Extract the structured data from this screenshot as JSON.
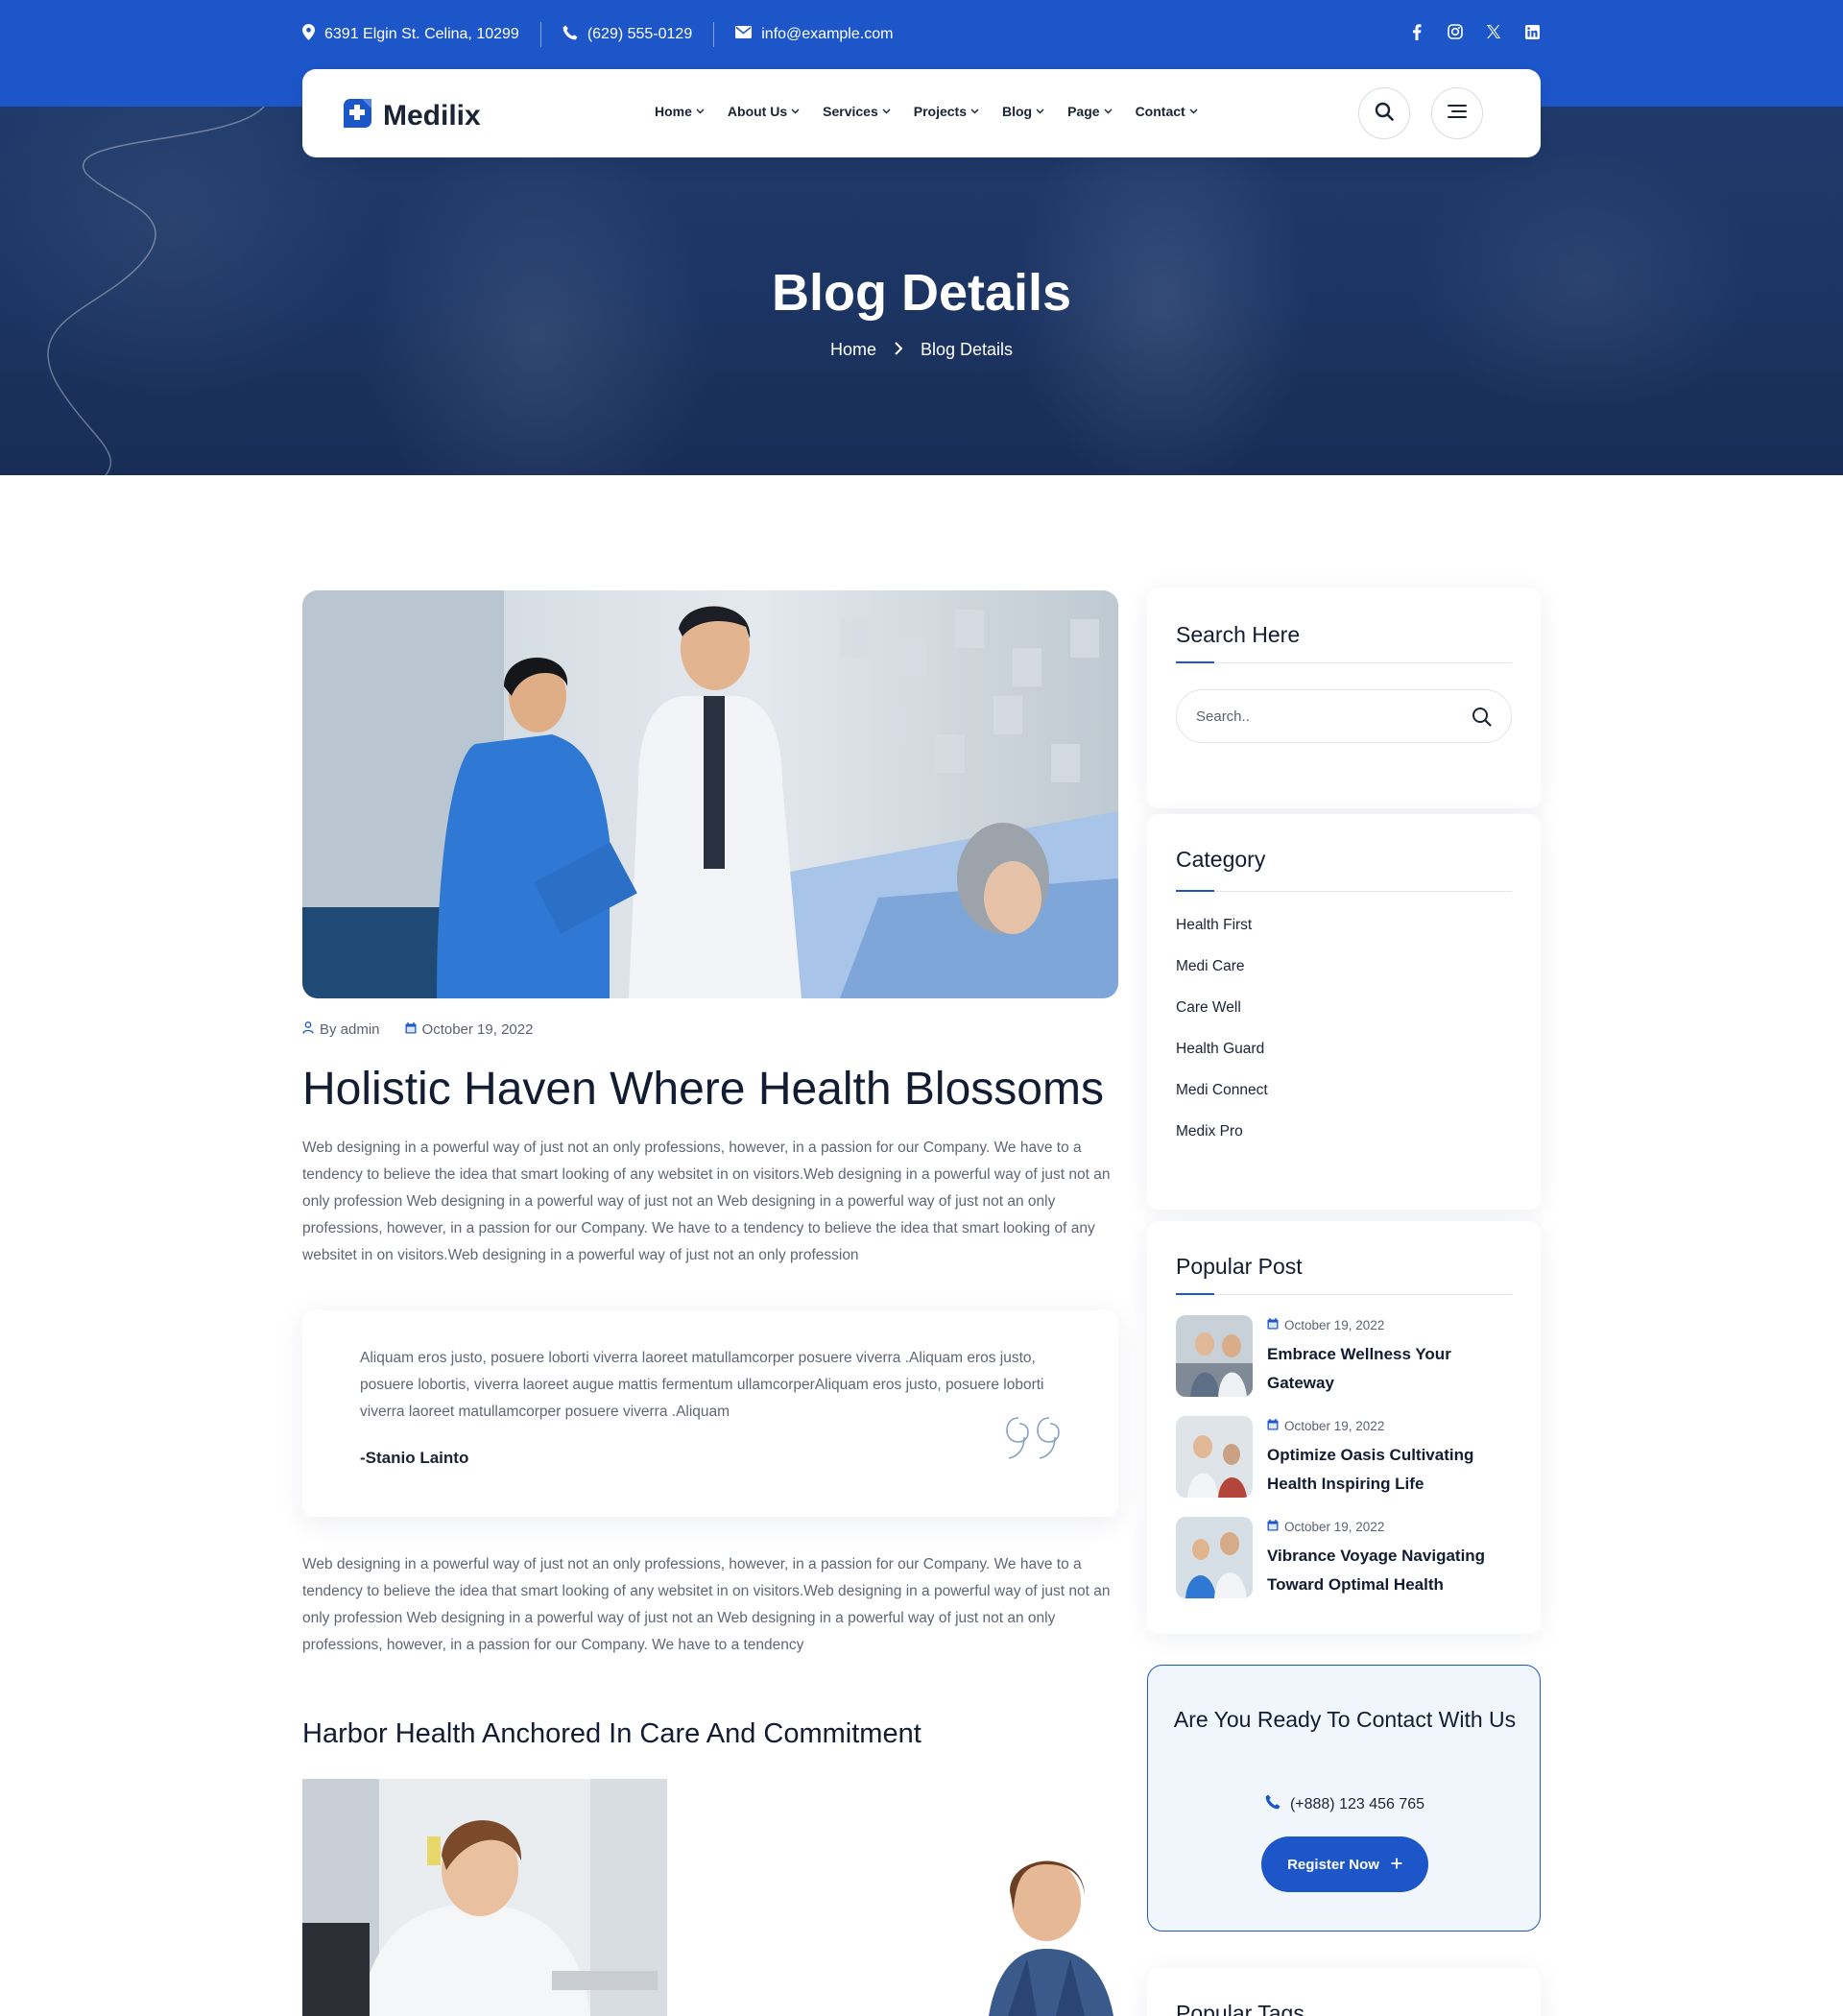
{
  "topbar": {
    "address": "6391 Elgin St. Celina, 10299",
    "phone": "(629) 555-0129",
    "email": "info@example.com",
    "social": [
      "facebook-icon",
      "instagram-icon",
      "x-icon",
      "linkedin-icon"
    ]
  },
  "brand": {
    "name": "Medilix",
    "accent": "#1d56c9",
    "dark": "#1b2435"
  },
  "nav": {
    "items": [
      "Home",
      "About Us",
      "Services",
      "Projects",
      "Blog",
      "Page",
      "Contact"
    ]
  },
  "hero": {
    "title": "Blog Details",
    "breadcrumb_home": "Home",
    "breadcrumb_current": "Blog Details"
  },
  "post": {
    "author": "By admin",
    "date": "October 19, 2022",
    "title": "Holistic Haven Where Health Blossoms",
    "para1": "Web designing in a powerful way of just not an only professions, however, in a passion for our Company. We have to a tendency to believe the idea that smart looking of any websitet in on visitors.Web designing in a powerful way of just not an only profession Web designing in a powerful way of just not an Web designing in a powerful way of just not an only professions, however, in a passion for our Company. We have to a tendency to believe the idea that smart looking of any websitet in on visitors.Web designing in a powerful way of just not an only profession",
    "quote": "Aliquam eros justo, posuere loborti viverra laoreet matullamcorper posuere viverra .Aliquam eros justo, posuere lobortis, viverra laoreet augue mattis fermentum ullamcorperAliquam eros justo, posuere loborti viverra laoreet matullamcorper posuere viverra .Aliquam",
    "quote_author": "-Stanio Lainto",
    "para2": "Web designing in a powerful way of just not an only professions, however, in a passion for our Company. We have to a tendency to believe the idea that smart looking of any websitet in on visitors.Web designing in a powerful way of just not an only profession Web designing in a powerful way of just not an Web designing in a powerful way of just not an only professions, however, in a passion for our Company. We have to a tendency",
    "subheading": "Harbor Health Anchored In Care And Commitment"
  },
  "sidebar": {
    "search_title": "Search Here",
    "search_placeholder": "Search..",
    "category_title": "Category",
    "categories": [
      "Health First",
      "Medi Care",
      "Care Well",
      "Health Guard",
      "Medi Connect",
      "Medix Pro"
    ],
    "popular_title": "Popular Post",
    "popular": [
      {
        "date": "October 19, 2022",
        "title": "Embrace Wellness Your Gateway"
      },
      {
        "date": "October 19, 2022",
        "title": "Optimize Oasis Cultivating Health Inspiring Life"
      },
      {
        "date": "October 19, 2022",
        "title": "Vibrance Voyage Navigating Toward Optimal Health"
      }
    ],
    "cta_title": "Are You Ready To Contact With Us",
    "cta_phone": "(+888) 123 456 765",
    "cta_button": "Register Now",
    "tags_title": "Popular Tags"
  }
}
